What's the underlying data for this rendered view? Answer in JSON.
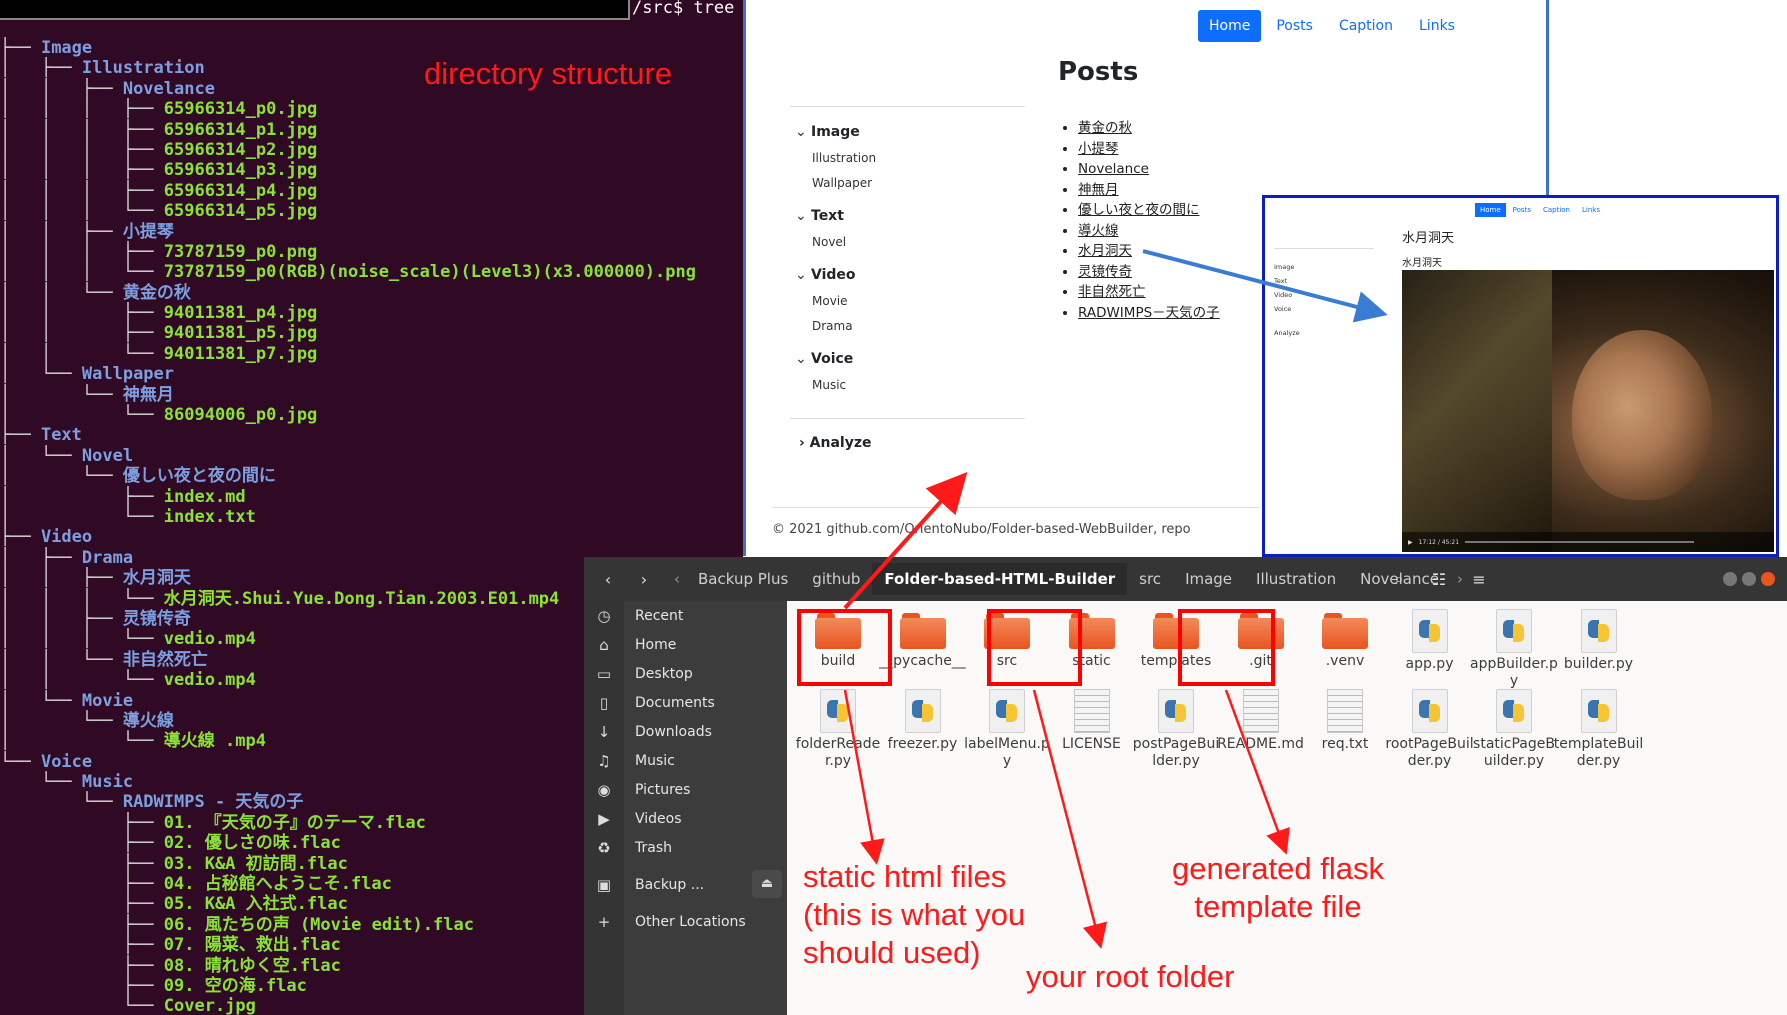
{
  "terminal": {
    "prompt": "/src$ tree",
    "note": "directory structure",
    "tree": [
      {
        "p": "├── ",
        "n": "Image",
        "t": "dir"
      },
      {
        "p": "│   ├── ",
        "n": "Illustration",
        "t": "dir"
      },
      {
        "p": "│   │   ├── ",
        "n": "Novelance",
        "t": "dir"
      },
      {
        "p": "│   │   │   ├── ",
        "n": "65966314_p0.jpg",
        "t": "file"
      },
      {
        "p": "│   │   │   ├── ",
        "n": "65966314_p1.jpg",
        "t": "file"
      },
      {
        "p": "│   │   │   ├── ",
        "n": "65966314_p2.jpg",
        "t": "file"
      },
      {
        "p": "│   │   │   ├── ",
        "n": "65966314_p3.jpg",
        "t": "file"
      },
      {
        "p": "│   │   │   ├── ",
        "n": "65966314_p4.jpg",
        "t": "file"
      },
      {
        "p": "│   │   │   └── ",
        "n": "65966314_p5.jpg",
        "t": "file"
      },
      {
        "p": "│   │   ├── ",
        "n": "小提琴",
        "t": "dir"
      },
      {
        "p": "│   │   │   ├── ",
        "n": "73787159_p0.png",
        "t": "file"
      },
      {
        "p": "│   │   │   └── ",
        "n": "73787159_p0(RGB)(noise_scale)(Level3)(x3.000000).png",
        "t": "file"
      },
      {
        "p": "│   │   └── ",
        "n": "黄金の秋",
        "t": "dir"
      },
      {
        "p": "│   │       ├── ",
        "n": "94011381_p4.jpg",
        "t": "file"
      },
      {
        "p": "│   │       ├── ",
        "n": "94011381_p5.jpg",
        "t": "file"
      },
      {
        "p": "│   │       └── ",
        "n": "94011381_p7.jpg",
        "t": "file"
      },
      {
        "p": "│   └── ",
        "n": "Wallpaper",
        "t": "dir"
      },
      {
        "p": "│       └── ",
        "n": "神無月",
        "t": "dir"
      },
      {
        "p": "│           └── ",
        "n": "86094006_p0.jpg",
        "t": "file"
      },
      {
        "p": "├── ",
        "n": "Text",
        "t": "dir"
      },
      {
        "p": "│   └── ",
        "n": "Novel",
        "t": "dir"
      },
      {
        "p": "│       └── ",
        "n": "優しい夜と夜の間に",
        "t": "dir"
      },
      {
        "p": "│           ├── ",
        "n": "index.md",
        "t": "file"
      },
      {
        "p": "│           └── ",
        "n": "index.txt",
        "t": "file"
      },
      {
        "p": "├── ",
        "n": "Video",
        "t": "dir"
      },
      {
        "p": "│   ├── ",
        "n": "Drama",
        "t": "dir"
      },
      {
        "p": "│   │   ├── ",
        "n": "水月洞天",
        "t": "dir"
      },
      {
        "p": "│   │   │   └── ",
        "n": "水月洞天.Shui.Yue.Dong.Tian.2003.E01.mp4",
        "t": "file"
      },
      {
        "p": "│   │   ├── ",
        "n": "灵镜传奇",
        "t": "dir"
      },
      {
        "p": "│   │   │   └── ",
        "n": "vedio.mp4",
        "t": "file"
      },
      {
        "p": "│   │   └── ",
        "n": "非自然死亡",
        "t": "dir"
      },
      {
        "p": "│   │       └── ",
        "n": "vedio.mp4",
        "t": "file"
      },
      {
        "p": "│   └── ",
        "n": "Movie",
        "t": "dir"
      },
      {
        "p": "│       └── ",
        "n": "導火線",
        "t": "dir"
      },
      {
        "p": "│           └── ",
        "n": "導火線 .mp4",
        "t": "file"
      },
      {
        "p": "└── ",
        "n": "Voice",
        "t": "dir"
      },
      {
        "p": "    └── ",
        "n": "Music",
        "t": "dir"
      },
      {
        "p": "        └── ",
        "n": "RADWIMPS - 天気の子",
        "t": "dir"
      },
      {
        "p": "            ├── ",
        "n": "01. 『天気の子』のテーマ.flac",
        "t": "file"
      },
      {
        "p": "            ├── ",
        "n": "02. 優しさの味.flac",
        "t": "file"
      },
      {
        "p": "            ├── ",
        "n": "03. K&A 初訪問.flac",
        "t": "file"
      },
      {
        "p": "            ├── ",
        "n": "04. 占秘館へようこそ.flac",
        "t": "file"
      },
      {
        "p": "            ├── ",
        "n": "05. K&A 入社式.flac",
        "t": "file"
      },
      {
        "p": "            ├── ",
        "n": "06. 風たちの声 (Movie edit).flac",
        "t": "file"
      },
      {
        "p": "            ├── ",
        "n": "07. 陽菜、救出.flac",
        "t": "file"
      },
      {
        "p": "            ├── ",
        "n": "08. 晴れゆく空.flac",
        "t": "file"
      },
      {
        "p": "            ├── ",
        "n": "09. 空の海.flac",
        "t": "file"
      },
      {
        "p": "            └── ",
        "n": "Cover.jpg",
        "t": "file"
      }
    ]
  },
  "webpage": {
    "nav": [
      "Home",
      "Posts",
      "Caption",
      "Links"
    ],
    "active_nav": "Home",
    "title": "Posts",
    "sidebar": [
      {
        "label": "Image",
        "items": [
          "Illustration",
          "Wallpaper"
        ]
      },
      {
        "label": "Text",
        "items": [
          "Novel"
        ]
      },
      {
        "label": "Video",
        "items": [
          "Movie",
          "Drama"
        ]
      },
      {
        "label": "Voice",
        "items": [
          "Music"
        ]
      }
    ],
    "analyze": "Analyze",
    "posts": [
      "黄金の秋",
      "小提琴",
      "Novelance",
      "神無月",
      "優しい夜と夜の間に",
      "導火線",
      "水月洞天",
      "灵镜传奇",
      "非自然死亡",
      "RADWIMPS－天気の子"
    ],
    "footer": "© 2021 github.com/OrientoNubo/Folder-based-WebBuilder, repo"
  },
  "preview": {
    "nav": [
      "Home",
      "Posts",
      "Caption",
      "Links"
    ],
    "title": "水月洞天",
    "subtitle": "水月洞天",
    "sidebar": [
      "Image",
      "Text",
      "Video",
      "Voice",
      "Analyze"
    ],
    "time": "17:12 / 45:21"
  },
  "file_manager": {
    "path": [
      "Backup Plus",
      "github",
      "Folder-based-HTML-Builder",
      "src",
      "Image",
      "Illustration",
      "Novelance"
    ],
    "current": "Folder-based-HTML-Builder",
    "places": [
      "Recent",
      "Home",
      "Desktop",
      "Documents",
      "Downloads",
      "Music",
      "Pictures",
      "Videos",
      "Trash",
      "Backup ...",
      "Other Locations"
    ],
    "files_row1": [
      {
        "name": "build",
        "kind": "folder"
      },
      {
        "name": "__pycache__",
        "kind": "folder"
      },
      {
        "name": "src",
        "kind": "folder"
      },
      {
        "name": "static",
        "kind": "folder"
      },
      {
        "name": "templates",
        "kind": "folder"
      },
      {
        "name": ".git",
        "kind": "folder"
      },
      {
        "name": ".venv",
        "kind": "folder"
      },
      {
        "name": "app.py",
        "kind": "py"
      },
      {
        "name": "appBuilder.py",
        "kind": "py"
      },
      {
        "name": "builder.py",
        "kind": "py"
      }
    ],
    "files_row2": [
      {
        "name": "folderReader.py",
        "kind": "py"
      },
      {
        "name": "freezer.py",
        "kind": "py"
      },
      {
        "name": "labelMenu.py",
        "kind": "py"
      },
      {
        "name": "LICENSE",
        "kind": "txt"
      },
      {
        "name": "postPageBuilder.py",
        "kind": "py"
      },
      {
        "name": "README.md",
        "kind": "txt"
      },
      {
        "name": "req.txt",
        "kind": "txt"
      },
      {
        "name": "rootPageBuilder.py",
        "kind": "py"
      },
      {
        "name": "staticPageBuilder.py",
        "kind": "py"
      },
      {
        "name": "templateBuilder.py",
        "kind": "py"
      }
    ]
  },
  "annotations": {
    "static": "static html files\n(this is what you\nshould used)",
    "root": "your root folder",
    "templates": "generated flask\ntemplate file"
  },
  "colors": {
    "annotation": "#ff1a1a",
    "arrow_blue": "#3a7bd5",
    "terminal_bg": "#300a24",
    "accent": "#e95420",
    "bootstrap_blue": "#0d6efd"
  }
}
